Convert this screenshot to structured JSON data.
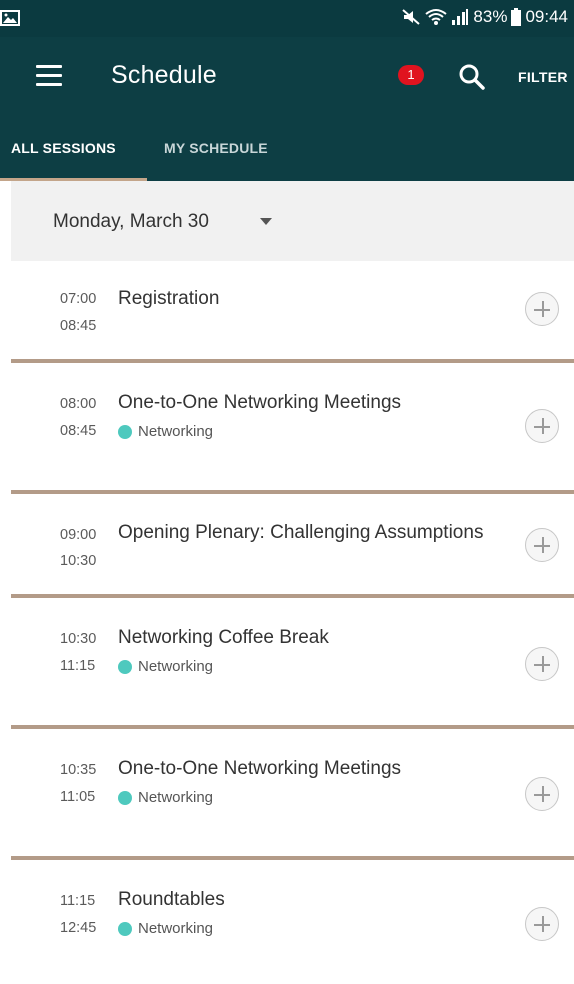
{
  "status_bar": {
    "battery": "83%",
    "time": "09:44"
  },
  "app_bar": {
    "title": "Schedule",
    "notification_count": "1",
    "filter_label": "FILTER"
  },
  "tabs": [
    {
      "label": "ALL SESSIONS",
      "active": true
    },
    {
      "label": "MY SCHEDULE",
      "active": false
    }
  ],
  "date_selector": {
    "label": "Monday, March 30"
  },
  "sessions": [
    {
      "start": "07:00",
      "end": "08:45",
      "title": "Registration",
      "tag": ""
    },
    {
      "start": "08:00",
      "end": "08:45",
      "title": "One-to-One Networking Meetings",
      "tag": "Networking"
    },
    {
      "start": "09:00",
      "end": "10:30",
      "title": "Opening Plenary: Challenging Assumptions",
      "tag": ""
    },
    {
      "start": "10:30",
      "end": "11:15",
      "title": "Networking Coffee Break",
      "tag": "Networking"
    },
    {
      "start": "10:35",
      "end": "11:05",
      "title": "One-to-One Networking Meetings",
      "tag": "Networking"
    },
    {
      "start": "11:15",
      "end": "12:45",
      "title": "Roundtables",
      "tag": "Networking"
    }
  ],
  "colors": {
    "app_bar": "#0d3e44",
    "status_bar": "#0b3a40",
    "tab_indicator": "#c3a58a",
    "divider": "#b39b88",
    "networking_tag": "#4ec9be",
    "badge": "#e0131f"
  }
}
